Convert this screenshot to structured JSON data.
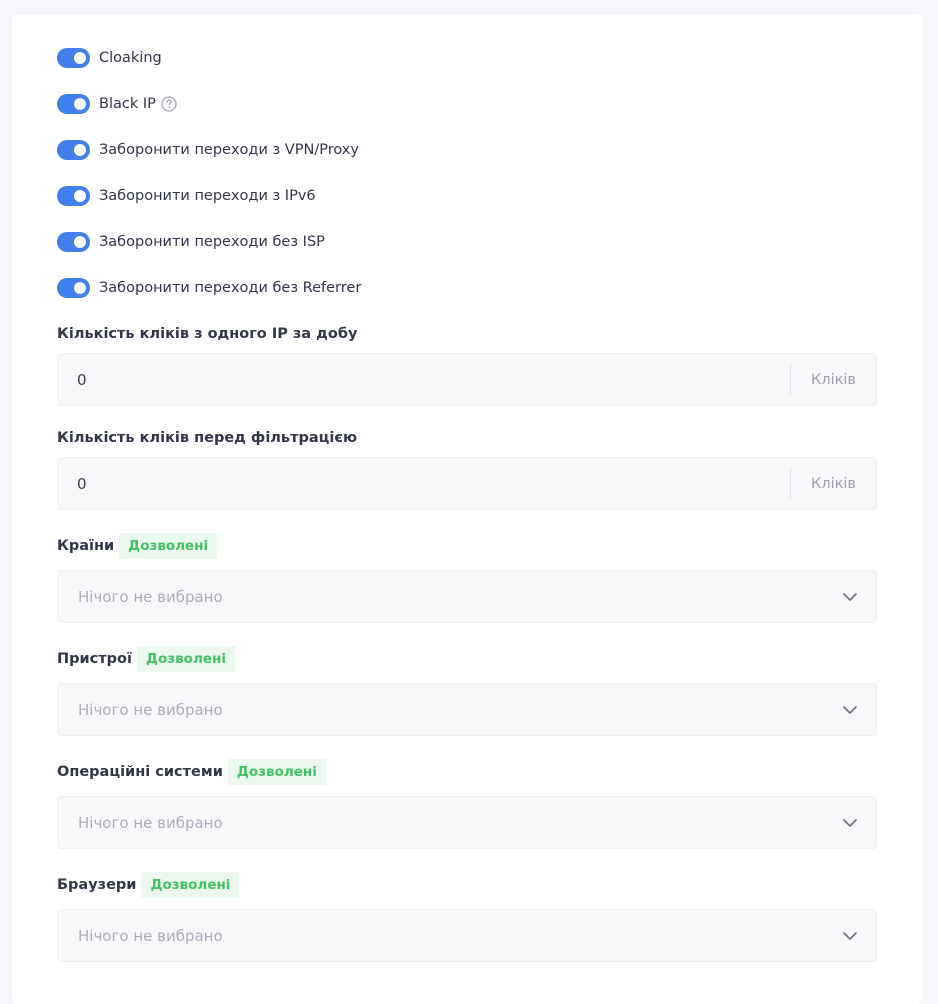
{
  "toggles": [
    {
      "label": "Cloaking",
      "on": true
    },
    {
      "label": "Black IP",
      "on": true,
      "help_icon": "question-circle-icon"
    },
    {
      "label": "Заборонити переходи з VPN/Proxy",
      "on": true
    },
    {
      "label": "Заборонити переходи з IPv6",
      "on": true
    },
    {
      "label": "Заборонити переходи без ISP",
      "on": true
    },
    {
      "label": "Заборонити переходи без Referrer",
      "on": true
    }
  ],
  "clicks_per_ip": {
    "label": "Кількість кліків з одного IP за добу",
    "value": "0",
    "suffix": "Кліків"
  },
  "clicks_before_filter": {
    "label": "Кількість кліків перед фільтрацією",
    "value": "0",
    "suffix": "Кліків"
  },
  "countries": {
    "label": "Країни",
    "badge": "Дозволені",
    "placeholder": "Нічого не вибрано"
  },
  "devices": {
    "label": "Пристрої",
    "badge": "Дозволені",
    "placeholder": "Нічого не вибрано"
  },
  "os": {
    "label": "Операційні системи",
    "badge": "Дозволені",
    "placeholder": "Нічого не вибрано"
  },
  "browsers": {
    "label": "Браузери",
    "badge": "Дозволені",
    "placeholder": "Нічого не вибрано"
  },
  "colors": {
    "toggle_on": "#4180ec",
    "badge_text": "#43c166",
    "badge_bg": "#ebf8ee",
    "page_bg": "#f5f5fa"
  },
  "icons": {
    "chevron": "chevron-down-icon",
    "help": "question-circle-icon"
  }
}
